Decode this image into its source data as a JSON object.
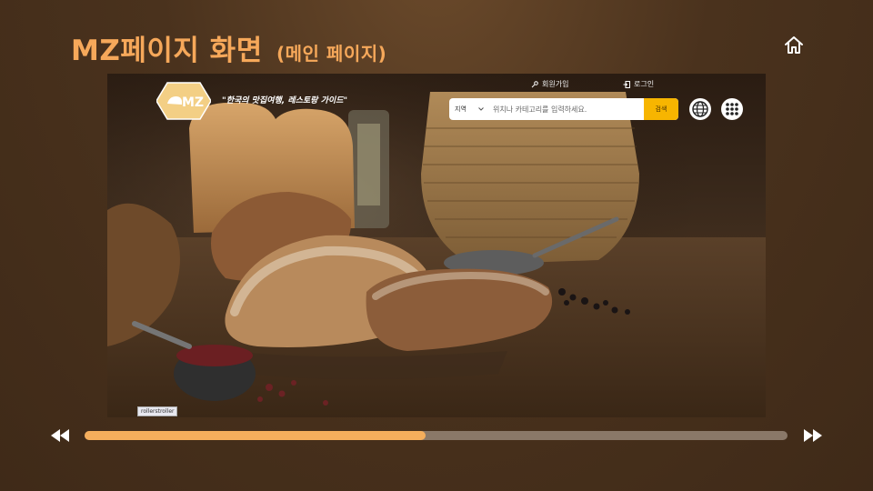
{
  "slide": {
    "title": "MZ페이지 화면",
    "subtitle": "(메인 페이지)",
    "home_icon": "home-icon"
  },
  "site": {
    "logo_text": "MZ",
    "logo_icon": "bread-icon",
    "tagline": "\"한국의 맛집여행, 레스토랑 가이드\"",
    "signup_label": "회원가입",
    "signup_icon": "key-icon",
    "login_label": "로그인",
    "login_icon": "login-icon",
    "search": {
      "region_label": "지역",
      "placeholder": "위치나 카테고리를 입력하세요.",
      "button_label": "검색"
    },
    "language_icon": "globe-icon",
    "menu_icon": "grid-menu-icon",
    "image_tag": "rollerstroller"
  },
  "player": {
    "rewind_icon": "rewind-icon",
    "forward_icon": "fast-forward-icon",
    "progress_fraction": 0.485,
    "colors": {
      "fill": "#f5ae5c",
      "track": "#8a7868"
    }
  },
  "colors": {
    "title": "#f6a85a",
    "search_button": "#f7b500",
    "logo_bg": "#f3cf85"
  }
}
